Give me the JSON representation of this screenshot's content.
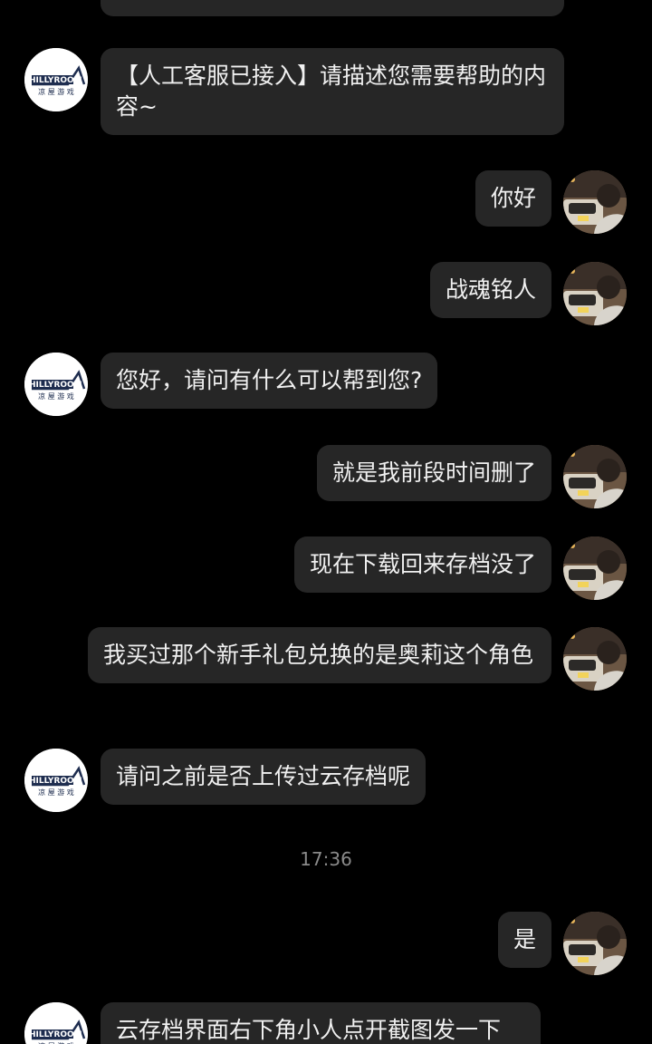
{
  "colors": {
    "background": "#000000",
    "bubble": "#262626",
    "text": "#f0f0f0",
    "timestamp": "#8a8a8a",
    "brand_navy": "#1e2d4f"
  },
  "service_avatar": {
    "icon": "chillyroom-logo-icon",
    "brand_text": "CHILLYROOM",
    "brand_sub": "凉屋游戏"
  },
  "user_avatar": {
    "icon": "user-photo-icon"
  },
  "messages": [
    {
      "sender": "service",
      "text": "【人工客服已接入】请描述您需要帮助的内容~"
    },
    {
      "sender": "user",
      "text": "你好"
    },
    {
      "sender": "user",
      "text": "战魂铭人"
    },
    {
      "sender": "service",
      "text": "您好，请问有什么可以帮到您?"
    },
    {
      "sender": "user",
      "text": "就是我前段时间删了"
    },
    {
      "sender": "user",
      "text": "现在下载回来存档没了"
    },
    {
      "sender": "user",
      "text": "我买过那个新手礼包兑换的是奥莉这个角色"
    },
    {
      "sender": "service",
      "text": "请问之前是否上传过云存档呢"
    },
    {
      "sender": "user",
      "text": "是"
    },
    {
      "sender": "service",
      "text": "云存档界面右下角小人点开截图发一下"
    }
  ],
  "timestamp": "17:36"
}
